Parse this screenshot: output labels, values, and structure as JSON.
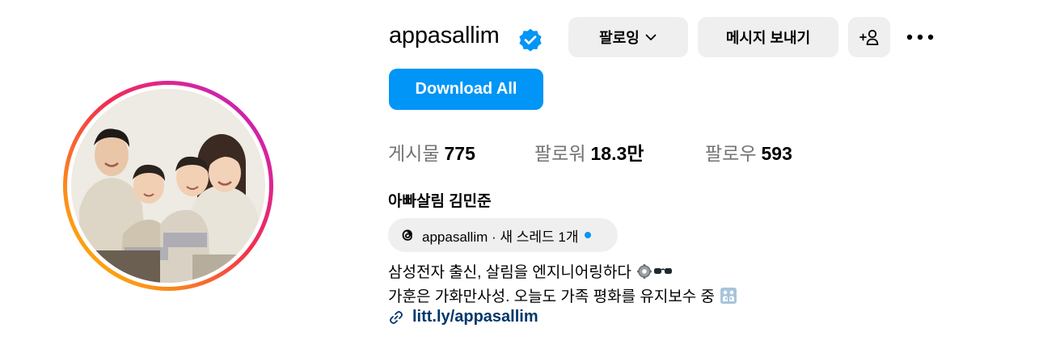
{
  "profile": {
    "username": "appasallim",
    "full_name": "아빠살림 김민준",
    "verified": true
  },
  "actions": {
    "follow_label": "팔로잉",
    "message_label": "메시지 보내기",
    "add_user_icon": "add-user-icon",
    "more_icon": "more-icon",
    "download_label": "Download All"
  },
  "stats": {
    "posts_label": "게시물",
    "posts_value": "775",
    "followers_label": "팔로워",
    "followers_value": "18.3만",
    "following_label": "팔로우",
    "following_value": "593"
  },
  "threads": {
    "text": "appasallim · 새 스레드 1개",
    "icon": "threads-icon"
  },
  "bio": {
    "line1": "삼성전자 출신, 살림을 엔지니어링하다",
    "line2": "가훈은 가화만사성. 오늘도 가족 평화를 유지보수 중"
  },
  "link": {
    "text": "litt.ly/appasallim",
    "icon": "link-icon"
  },
  "colors": {
    "primary_button": "#0095f6",
    "secondary_button": "#efefef",
    "link_text": "#00376b",
    "verified_badge": "#0095f6",
    "muted_text": "#737373"
  }
}
